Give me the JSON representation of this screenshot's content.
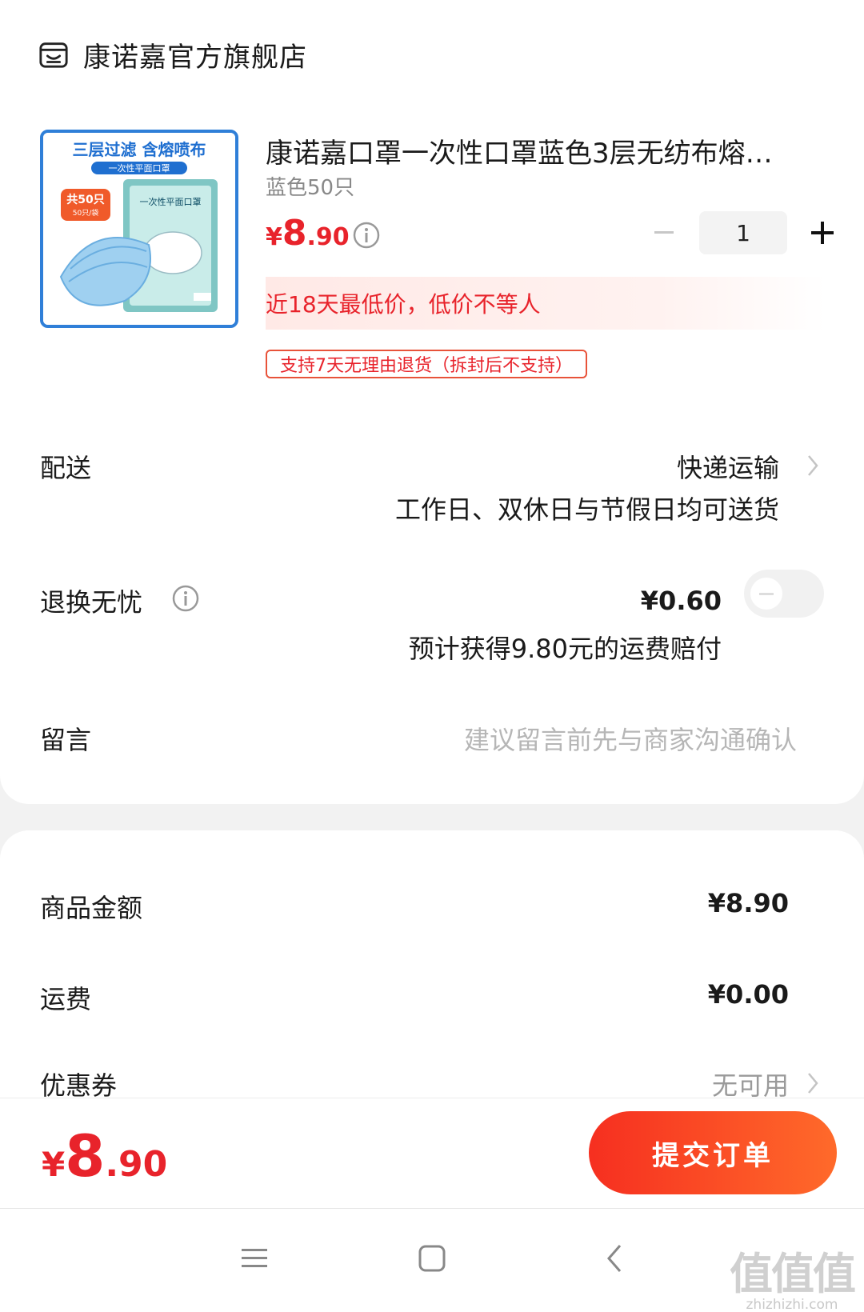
{
  "store": {
    "name": "康诺嘉官方旗舰店",
    "icon": "store-icon"
  },
  "product": {
    "title": "康诺嘉口罩一次性口罩蓝色3层无纺布熔…",
    "variant": "蓝色50只",
    "price_yen": "¥",
    "price_int": "8",
    "price_dec": ".90",
    "quantity": "1",
    "lowest_price_note": "近18天最低价，低价不等人",
    "return_policy": "支持7天无理由退货（拆封后不支持）",
    "image": {
      "headline": "三层过滤 含熔喷布",
      "subline": "一次性平面口罩",
      "badge_main": "共50只",
      "badge_sub": "50只/袋",
      "pack_label": "一次性平面口罩"
    }
  },
  "delivery": {
    "label": "配送",
    "method": "快递运输",
    "note": "工作日、双休日与节假日均可送货"
  },
  "return_insurance": {
    "label": "退换无忧",
    "price": "¥0.60",
    "note": "预计获得9.80元的运费赔付",
    "enabled": false
  },
  "message": {
    "label": "留言",
    "placeholder": "建议留言前先与商家沟通确认"
  },
  "summary": {
    "goods_label": "商品金额",
    "goods_value": "¥8.90",
    "shipping_label": "运费",
    "shipping_value": "¥0.00",
    "coupon_label": "优惠券",
    "coupon_value": "无可用"
  },
  "checkout": {
    "total_yen": "¥",
    "total_int": "8",
    "total_dec": ".90",
    "submit_label": "提交订单"
  },
  "watermark": {
    "logo": "值值值",
    "url": "zhizhizhi.com"
  },
  "colors": {
    "accent": "#e8232b",
    "button_start": "#f62f20",
    "button_end": "#ff6a2a"
  }
}
